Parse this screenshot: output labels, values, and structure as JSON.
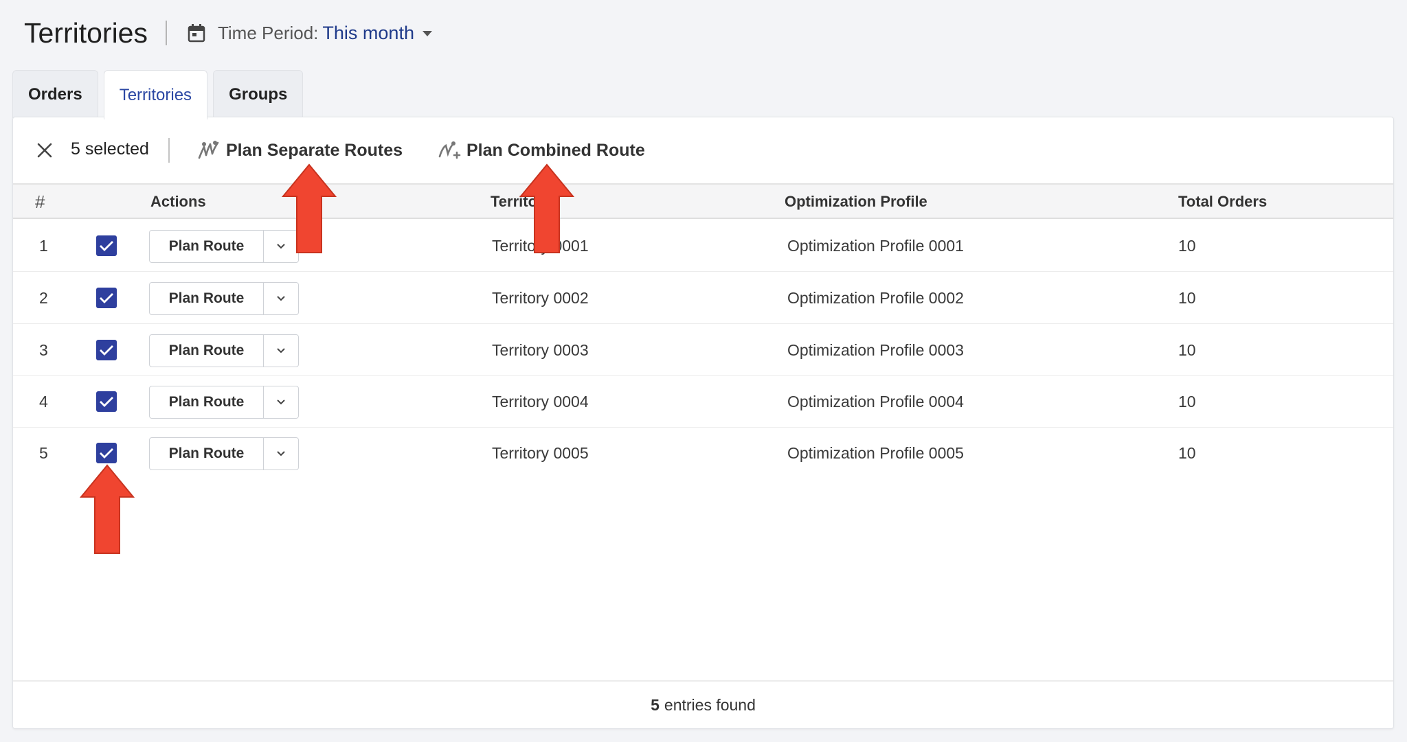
{
  "header": {
    "title": "Territories",
    "time_period_label": "Time Period:",
    "time_period_value": "This month"
  },
  "tabs": [
    {
      "label": "Orders",
      "active": false
    },
    {
      "label": "Territories",
      "active": true
    },
    {
      "label": "Groups",
      "active": false
    }
  ],
  "toolbar": {
    "selected_text": "5 selected",
    "plan_separate": "Plan Separate Routes",
    "plan_combined": "Plan Combined Route"
  },
  "table": {
    "columns": {
      "num": "#",
      "actions": "Actions",
      "territory": "Territory",
      "optimization_profile": "Optimization Profile",
      "total_orders": "Total Orders"
    },
    "action_label": "Plan Route",
    "rows": [
      {
        "num": "1",
        "checked": true,
        "territory": "Territory 0001",
        "optimization_profile": "Optimization Profile 0001",
        "total_orders": "10"
      },
      {
        "num": "2",
        "checked": true,
        "territory": "Territory 0002",
        "optimization_profile": "Optimization Profile 0002",
        "total_orders": "10"
      },
      {
        "num": "3",
        "checked": true,
        "territory": "Territory 0003",
        "optimization_profile": "Optimization Profile 0003",
        "total_orders": "10"
      },
      {
        "num": "4",
        "checked": true,
        "territory": "Territory 0004",
        "optimization_profile": "Optimization Profile 0004",
        "total_orders": "10"
      },
      {
        "num": "5",
        "checked": true,
        "territory": "Territory 0005",
        "optimization_profile": "Optimization Profile 0005",
        "total_orders": "10"
      }
    ]
  },
  "footer": {
    "count": "5",
    "suffix": "entries found"
  },
  "colors": {
    "accent": "#2e3f9e",
    "annotation_arrow": "#f04530"
  },
  "icons": [
    "calendar-icon",
    "chevron-down-icon",
    "close-icon",
    "plan-separate-routes-icon",
    "plan-combined-route-icon",
    "checkbox-checked-icon"
  ]
}
